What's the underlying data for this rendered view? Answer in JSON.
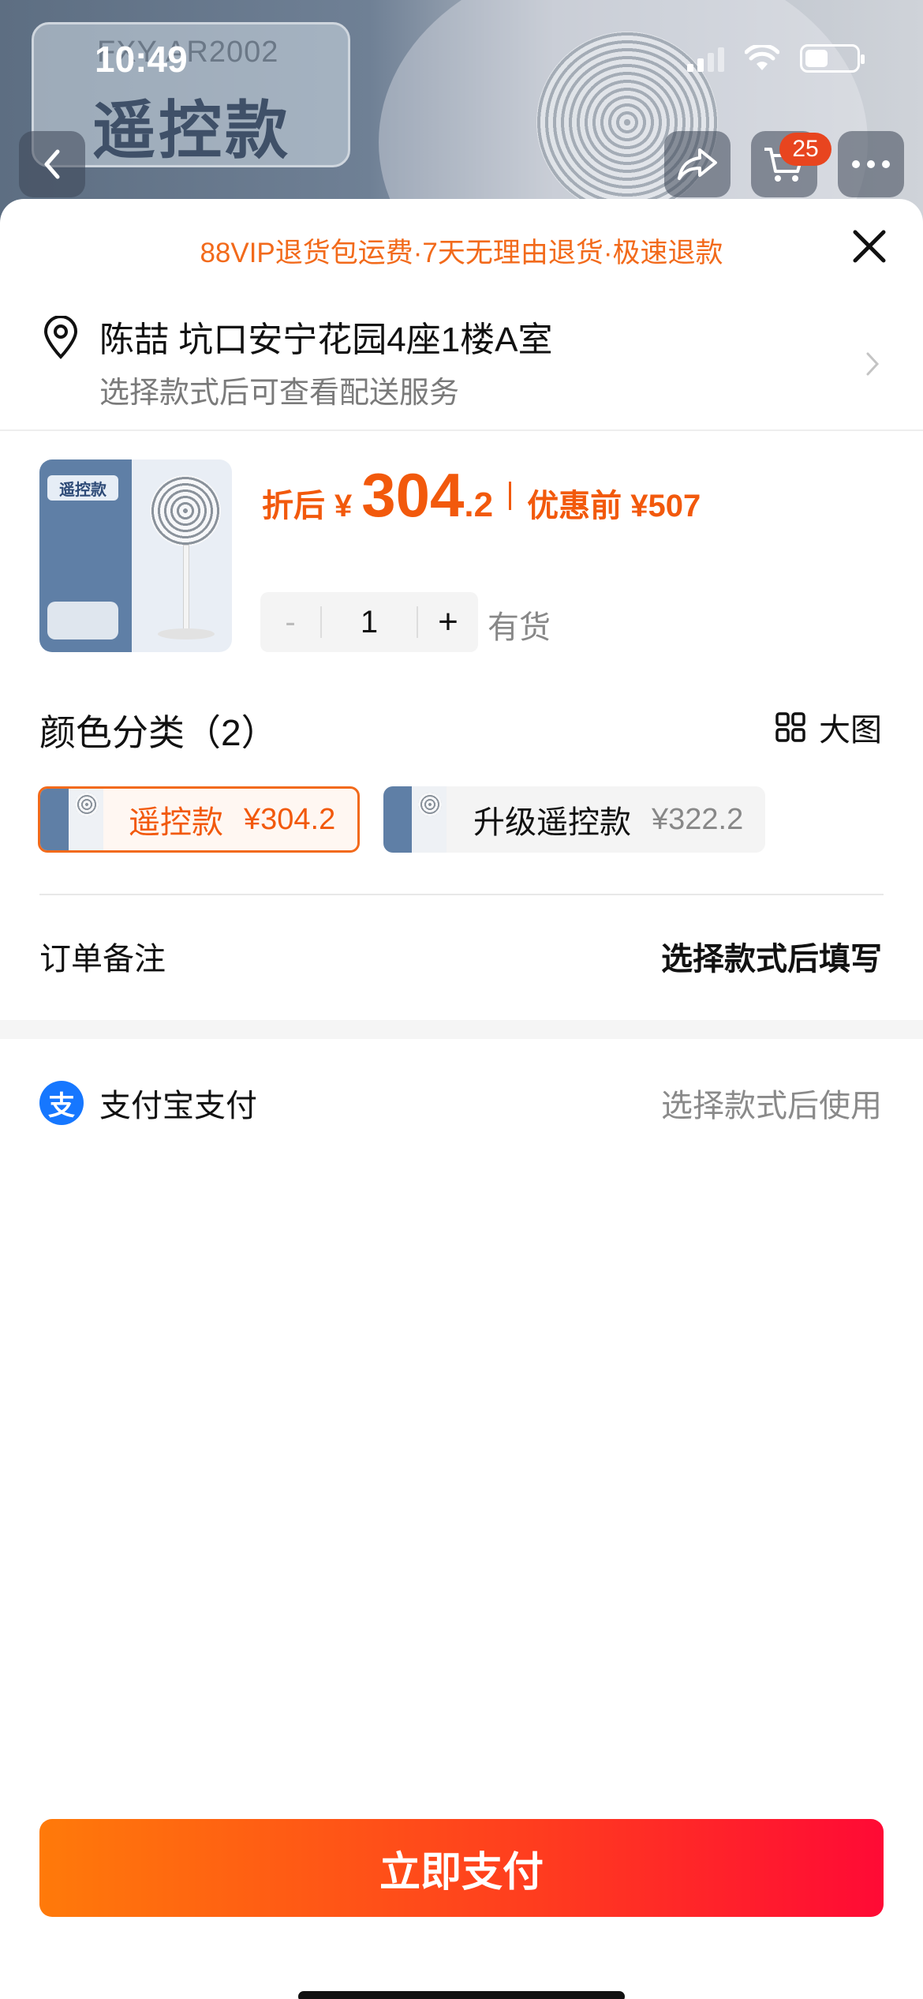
{
  "status_bar": {
    "time": "10:49"
  },
  "background": {
    "model_text": "FXY-AR2002",
    "title_text": "遥控款",
    "cart_badge": "25"
  },
  "sheet": {
    "promo": "88VIP退货包运费·7天无理由退货·极速退款",
    "address": {
      "name_line": "陈喆 坑口安宁花园4座1楼A室",
      "hint": "选择款式后可查看配送服务"
    },
    "product": {
      "thumb_label": "遥控款",
      "after_label": "折后",
      "currency": "¥",
      "price_int": "304",
      "price_dec": ".2",
      "pre_discount": "优惠前 ¥507",
      "quantity": "1",
      "minus": "-",
      "plus": "+",
      "stock": "有货"
    },
    "color_section": {
      "title": "颜色分类（2）",
      "big_view": "大图",
      "options": [
        {
          "name": "遥控款",
          "price": "¥304.2",
          "selected": true
        },
        {
          "name": "升级遥控款",
          "price": "¥322.2",
          "selected": false
        }
      ]
    },
    "order_note": {
      "label": "订单备注",
      "value": "选择款式后填写"
    },
    "payment": {
      "icon_char": "支",
      "label": "支付宝支付",
      "value": "选择款式后使用"
    },
    "pay_button": "立即支付"
  },
  "colors": {
    "accent": "#f2590c",
    "alipay": "#1677ff",
    "button_start": "#ff7a0a",
    "button_end": "#ff0a35"
  }
}
